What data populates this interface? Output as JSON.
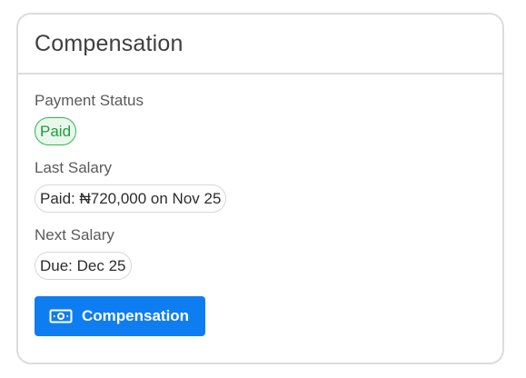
{
  "card": {
    "title": "Compensation"
  },
  "payment_status": {
    "label": "Payment Status",
    "value": "Paid"
  },
  "last_salary": {
    "label": "Last Salary",
    "value": "Paid: ₦720,000 on Nov 25"
  },
  "next_salary": {
    "label": "Next Salary",
    "value": "Due: Dec 25"
  },
  "action": {
    "label": "Compensation",
    "icon": "money-icon"
  },
  "colors": {
    "accent": "#0f7df2",
    "paid_green": "#1f9a3c",
    "paid_bg": "#eaf8ec",
    "border": "#dcdcdc"
  }
}
